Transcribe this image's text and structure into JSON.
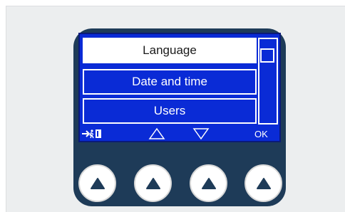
{
  "menu": {
    "items": [
      {
        "label": "Language",
        "selected": true
      },
      {
        "label": "Date and time",
        "selected": false
      },
      {
        "label": "Users",
        "selected": false
      }
    ]
  },
  "softkeys": {
    "exit_icon": "exit-door-icon",
    "up_icon": "triangle-up-outline-icon",
    "down_icon": "triangle-down-outline-icon",
    "ok_label": "OK"
  },
  "hardware_buttons": [
    {
      "icon": "triangle-up-filled-icon"
    },
    {
      "icon": "triangle-up-filled-icon"
    },
    {
      "icon": "triangle-up-filled-icon"
    },
    {
      "icon": "triangle-up-filled-icon"
    }
  ],
  "colors": {
    "screen_blue": "#0a2bd6",
    "device_body": "#1e3b58",
    "background": "#eceeef"
  }
}
